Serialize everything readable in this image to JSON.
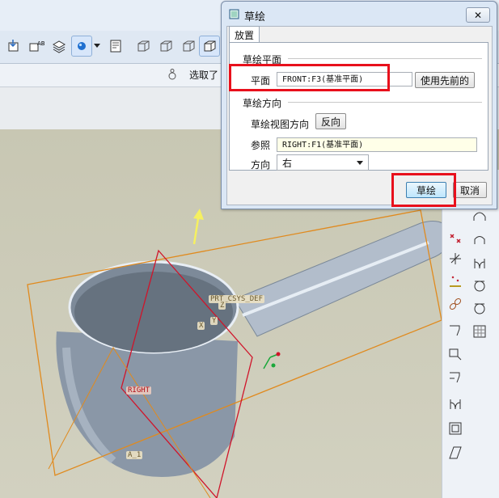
{
  "status_bar": {
    "label": "选取了"
  },
  "dialog": {
    "title": "草绘",
    "close_label": "✕",
    "tab_label": "放置",
    "sketch_plane": {
      "section_label": "草绘平面",
      "plane_label": "平面",
      "plane_value": "FRONT:F3(基准平面)",
      "use_previous_label": "使用先前的"
    },
    "sketch_orientation": {
      "section_label": "草绘方向",
      "view_direction_label": "草绘视图方向",
      "flip_label": "反向",
      "reference_label": "参照",
      "reference_value": "RIGHT:F1(基准平面)",
      "orientation_label": "方向",
      "orientation_value": "右"
    },
    "sketch_button_label": "草绘",
    "cancel_button_label": "取消"
  },
  "viewport": {
    "datum_labels": {
      "csys": "PRT_CSYS_DEF",
      "right": "RIGHT",
      "axis": "A_1",
      "z": "Z",
      "y": "Y",
      "x": "X"
    }
  },
  "colors": {
    "highlight": "#e8101c",
    "datum_orange": "#e08a1e",
    "datum_red": "#d0142a",
    "model_gray": "#8d9aa8",
    "arrow_yellow": "#f5f060"
  },
  "icons": [
    "save-copy-icon",
    "annotation-icon",
    "layers-icon",
    "display-style-icon",
    "view-manager-icon",
    "cube-view-icon",
    "appearance-icon",
    "sketch-dialog-icon",
    "close-icon"
  ]
}
